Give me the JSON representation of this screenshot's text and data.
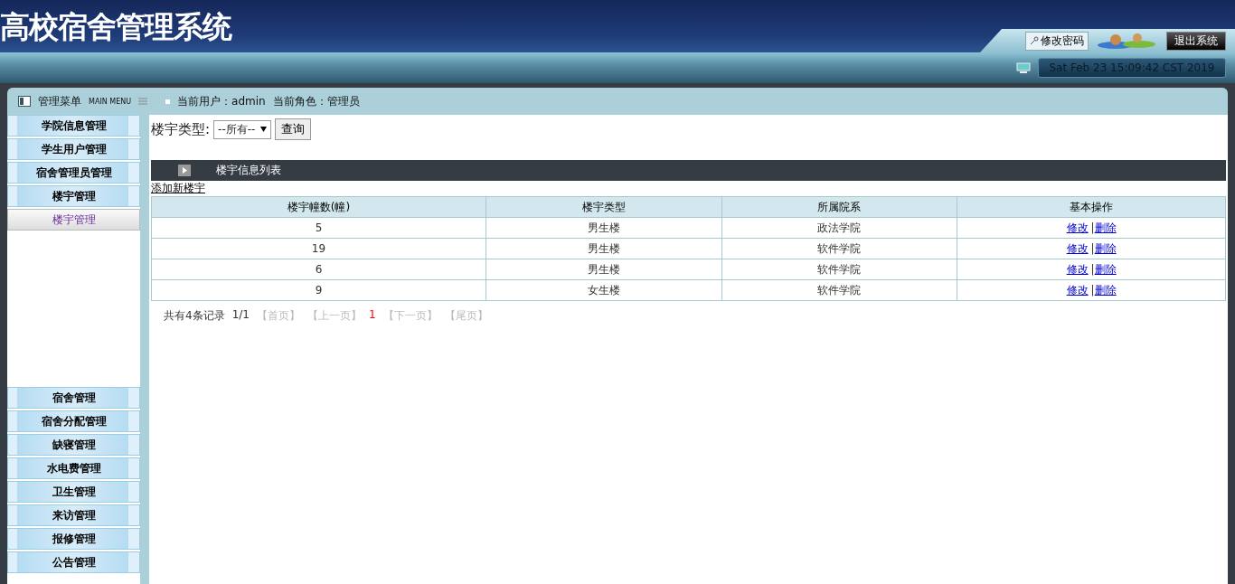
{
  "header": {
    "title": "高校宿舍管理系统",
    "change_password": "修改密码",
    "logout": "退出系统",
    "datetime": "Sat Feb 23 15:09:42 CST 2019"
  },
  "menu_bar": {
    "title": "管理菜单",
    "subtitle": "MAIN MENU",
    "user_label": "当前用户：admin",
    "role_label": "当前角色：管理员"
  },
  "sidebar": {
    "menus": [
      {
        "label": "学院信息管理"
      },
      {
        "label": "学生用户管理"
      },
      {
        "label": "宿舍管理员管理"
      },
      {
        "label": "楼宇管理",
        "children": [
          {
            "label": "楼宇管理",
            "selected": true
          }
        ]
      },
      {
        "label": "宿舍管理"
      },
      {
        "label": "宿舍分配管理"
      },
      {
        "label": "缺寝管理"
      },
      {
        "label": "水电费管理"
      },
      {
        "label": "卫生管理"
      },
      {
        "label": "来访管理"
      },
      {
        "label": "报修管理"
      },
      {
        "label": "公告管理"
      }
    ]
  },
  "filter": {
    "label": "楼宇类型:",
    "select_value": "--所有--",
    "button": "查询"
  },
  "list": {
    "title": "楼宇信息列表",
    "add_link": "添加新楼宇",
    "columns": [
      "楼宇幢数(幢)",
      "楼宇类型",
      "所属院系",
      "基本操作"
    ],
    "rows": [
      {
        "cells": [
          "5",
          "男生楼",
          "政法学院"
        ],
        "actions": [
          "修改",
          "删除"
        ],
        "separator": "|"
      },
      {
        "cells": [
          "19",
          "男生楼",
          "软件学院"
        ],
        "actions": [
          "修改",
          "删除"
        ],
        "separator": "|"
      },
      {
        "cells": [
          "6",
          "男生楼",
          "软件学院"
        ],
        "actions": [
          "修改",
          "删除"
        ],
        "separator": "|"
      },
      {
        "cells": [
          "9",
          "女生楼",
          "软件学院"
        ],
        "actions": [
          "修改",
          "删除"
        ],
        "separator": "|"
      }
    ]
  },
  "pager": [
    {
      "text": "共有4条记录",
      "kind": "info"
    },
    {
      "text": "1/1",
      "kind": "info"
    },
    {
      "text": "【首页】",
      "kind": "link",
      "disabled": true
    },
    {
      "text": "【上一页】",
      "kind": "link",
      "disabled": true
    },
    {
      "text": "1",
      "kind": "current"
    },
    {
      "text": "【下一页】",
      "kind": "link",
      "disabled": true
    },
    {
      "text": "【尾页】",
      "kind": "link",
      "disabled": true
    }
  ]
}
